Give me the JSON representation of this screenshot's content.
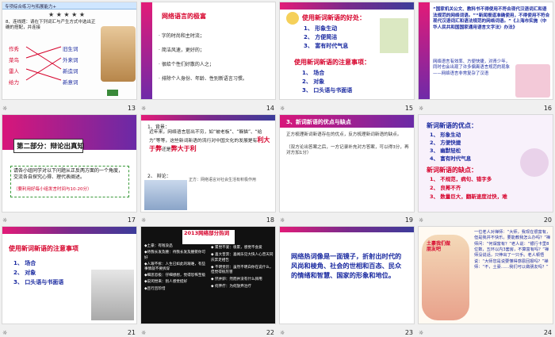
{
  "slides": [
    {
      "num": "13",
      "header": "专项综合练习与拓展能力+",
      "stars": "★ ★ ★ ★ ★",
      "q": "8、连线题：请在下列词汇与产生方式中选出正确的搭配，并连接",
      "left": [
        "作秀",
        "菜鸟",
        "雷人",
        "给力"
      ],
      "right": [
        "旧生词",
        "外来词",
        "新造词",
        "新意词"
      ]
    },
    {
      "num": "14",
      "title": "网络语言的极富",
      "items": [
        "· 字的时尚和主时流；",
        "· 简洁风速，更好的；",
        "· 很给个性们好散的人之；",
        "· 排除个人身份、年龄、性别新语言习惯。"
      ]
    },
    {
      "num": "15",
      "title": "使用新词新语的好处：",
      "list1": [
        "1、 形象生动",
        "2、 方便简洁",
        "3、 富有时代气息"
      ],
      "title2": "使用新词新语的注意事项：",
      "list2": [
        "1、 场合",
        "2、 对象",
        "3、 口头语与书面语"
      ]
    },
    {
      "num": "16",
      "text": "“国家机关公文、教科书不得使用不符合现代汉语词汇和语法规范的网络词语。”“新闻报道准确使用，不得使用不符合现代汉语词汇和语法规范的网络词语。”《上海市实施〈中华人民共和国国家通用语言文字法〉办法》",
      "text2": "网络语言有效率、方便快捷，对青少年，同时也会出现了许多偏离语言规范的现象——网络语言非常复杂了汉语"
    },
    {
      "num": "17",
      "title": "第二部分：辩论出真知",
      "body": "请各小组同学对以下问题从正反两方面的一个角度，交流各自探究心得、理代表阐述。",
      "note": "（要利用好每小组发言时间与10-20分）"
    },
    {
      "num": "18",
      "p1": "1、背景：",
      "p1b": "近年来，网络语言层出不穷，如“被老板”、“躲猫”、“给力”等等，这些新词新语的流行对中国文化的发展是有",
      "red1": "利大于弊",
      "mid": "还是",
      "red2": "弊大于利",
      "p2": "2、 辩论：",
      "p2b": "正方：网络语言对社会生活有积极作用"
    },
    {
      "num": "19",
      "title": "3、新词新语的优点与缺点",
      "items": [
        "正方梳理新词新语存在的优点，反方梳理新词新语的缺点。",
        "（双方论出答案之后，一方记录补充对方答案，可以得3分，再对方加1分）"
      ]
    },
    {
      "num": "20",
      "title": "新词新语的优点：",
      "list1": [
        "1、 形象生动",
        "2、 方便快捷",
        "3、 幽默轻松",
        "4、 富有时代气息"
      ],
      "title2": "新词新语的缺点：",
      "list2": [
        "1、 不规范，病句、错字多",
        "2、 良莠不齐",
        "3、 数量巨大，翻新速度过快，难"
      ]
    },
    {
      "num": "21",
      "title": "使用新词新语的注意事项",
      "items": [
        "1、 场合",
        "2、 对象",
        "3、 口头语与书面语"
      ]
    },
    {
      "num": "22",
      "title": "2013网络部分热词",
      "left": [
        "◆土豪：有钱没品",
        "◆待我长发及腰：待我长发及腰娶你可好",
        "◆人艰不拆：人生已如此的艰难，有些事情就不要拆穿",
        "◆细思恐极：仔细想想，觉得恐怖至极",
        "◆说闲觉来：别人感觉挺好",
        "◆且行且珍惜"
      ],
      "right": [
        "◆ 累觉不爱：很累，感觉不会爱",
        "◆ 喜大普奔：喜闻乐见大快人心普天同庆奔走相告",
        "◆ 不明觉厉：虽然不明白你在说什么，但觉得很厉害",
        "◆ 然并卵：然而并没有什么卵用",
        "◆ 何弃疗：为何放弃治疗"
      ]
    },
    {
      "num": "23",
      "body": "网络热词像是一面镜子，折射出时代的风尚和棱角、社会的世相和百态、民众的情绪和智慧、国家的形象和地位。"
    },
    {
      "num": "24",
      "body": "一位老人对禅师：“大师，我现在很富有，但是我并不快乐。要能教我怎么办吗？”禅师问：“何谓富有？”老人说：“银行卡里8位数，五环以内3套房，不算富有吗？”禅师没说话，只伸出了一只手。老人顿悟说：“大师您是说要懂得感恩回报吗？”禅师：“不，土豪……我们可以做朋友吗？”",
      "cartoon": "土豪我们做朋友吧"
    }
  ],
  "colors": {
    "red": "#d6002a",
    "blue": "#1a2aa0",
    "purple": "#6f2aa8",
    "pink": "#e21b78"
  }
}
